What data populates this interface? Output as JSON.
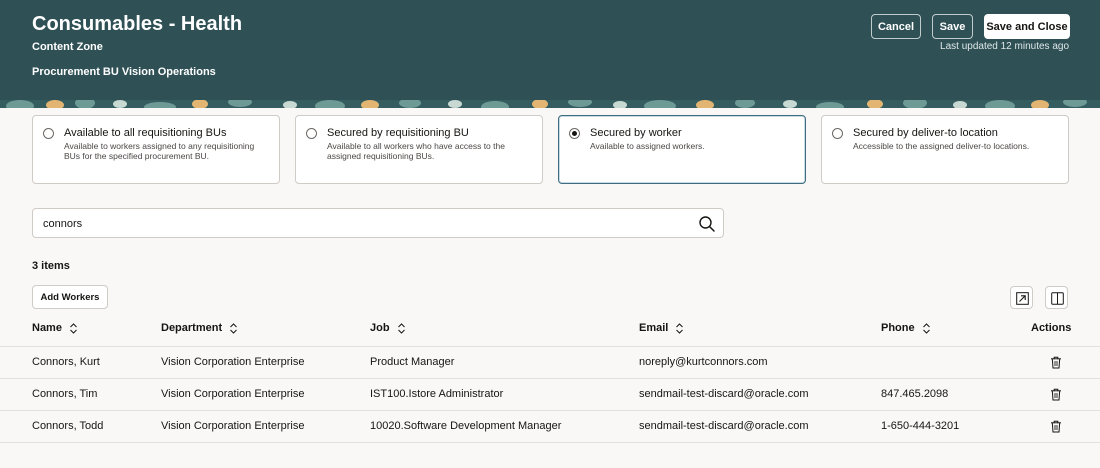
{
  "header": {
    "title": "Consumables - Health",
    "subtitle": "Content Zone",
    "bu_line": "Procurement BU Vision Operations",
    "cancel_label": "Cancel",
    "save_label": "Save",
    "save_close_label": "Save and Close",
    "last_updated": "Last updated 12 minutes ago",
    "background_color": "#2f5156"
  },
  "options": [
    {
      "title": "Available to all requisitioning BUs",
      "desc": "Available to workers assigned to any requisitioning BUs for the specified procurement BU.",
      "selected": false
    },
    {
      "title": "Secured by requisitioning BU",
      "desc": "Available to all workers who have access to the assigned requisitioning BUs.",
      "selected": false
    },
    {
      "title": "Secured by worker",
      "desc": "Available to assigned workers.",
      "selected": true
    },
    {
      "title": "Secured by deliver-to location",
      "desc": "Accessible to the assigned deliver-to locations.",
      "selected": false
    }
  ],
  "search": {
    "value": "connors",
    "icon": "search-icon"
  },
  "items_count": "3 items",
  "add_workers_label": "Add Workers",
  "table": {
    "columns": [
      "Name",
      "Department",
      "Job",
      "Email",
      "Phone",
      "Actions"
    ],
    "rows": [
      {
        "name": "Connors, Kurt",
        "department": "Vision Corporation Enterprise",
        "job": "Product Manager",
        "email": "noreply@kurtconnors.com",
        "phone": ""
      },
      {
        "name": "Connors, Tim",
        "department": "Vision Corporation Enterprise",
        "job": "IST100.Istore Administrator",
        "email": "sendmail-test-discard@oracle.com",
        "phone": "847.465.2098"
      },
      {
        "name": "Connors, Todd",
        "department": "Vision Corporation Enterprise",
        "job": "10020.Software Development Manager",
        "email": "sendmail-test-discard@oracle.com",
        "phone": "1-650-444-3201"
      }
    ]
  }
}
